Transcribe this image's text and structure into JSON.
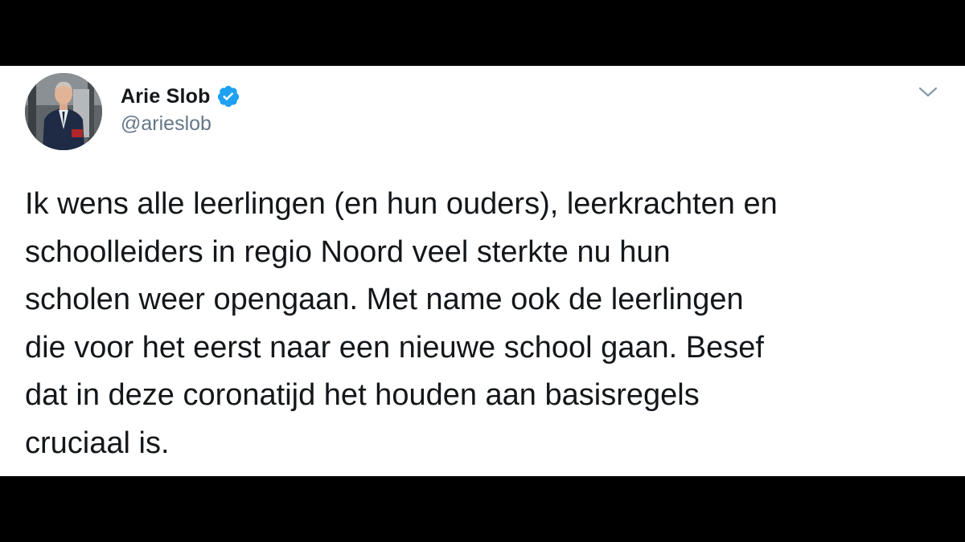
{
  "tweet": {
    "author_name": "Arie Slob",
    "handle": "@arieslob",
    "verified_icon": "verified-badge-icon",
    "menu_icon": "chevron-down-icon",
    "text": "Ik wens alle leerlingen (en hun ouders), leerkrachten en\nschoolleiders in regio Noord veel sterkte nu hun\nscholen weer opengaan. Met name ook de leerlingen\ndie voor het eerst naar een nieuwe school gaan. Besef\ndat in deze coronatijd het houden aan basisregels\ncruciaal is."
  },
  "colors": {
    "letterbox": "#000000",
    "card_background": "#ffffff",
    "name_text": "#14171a",
    "handle_text": "#657786",
    "verified_blue": "#1da1f2"
  }
}
